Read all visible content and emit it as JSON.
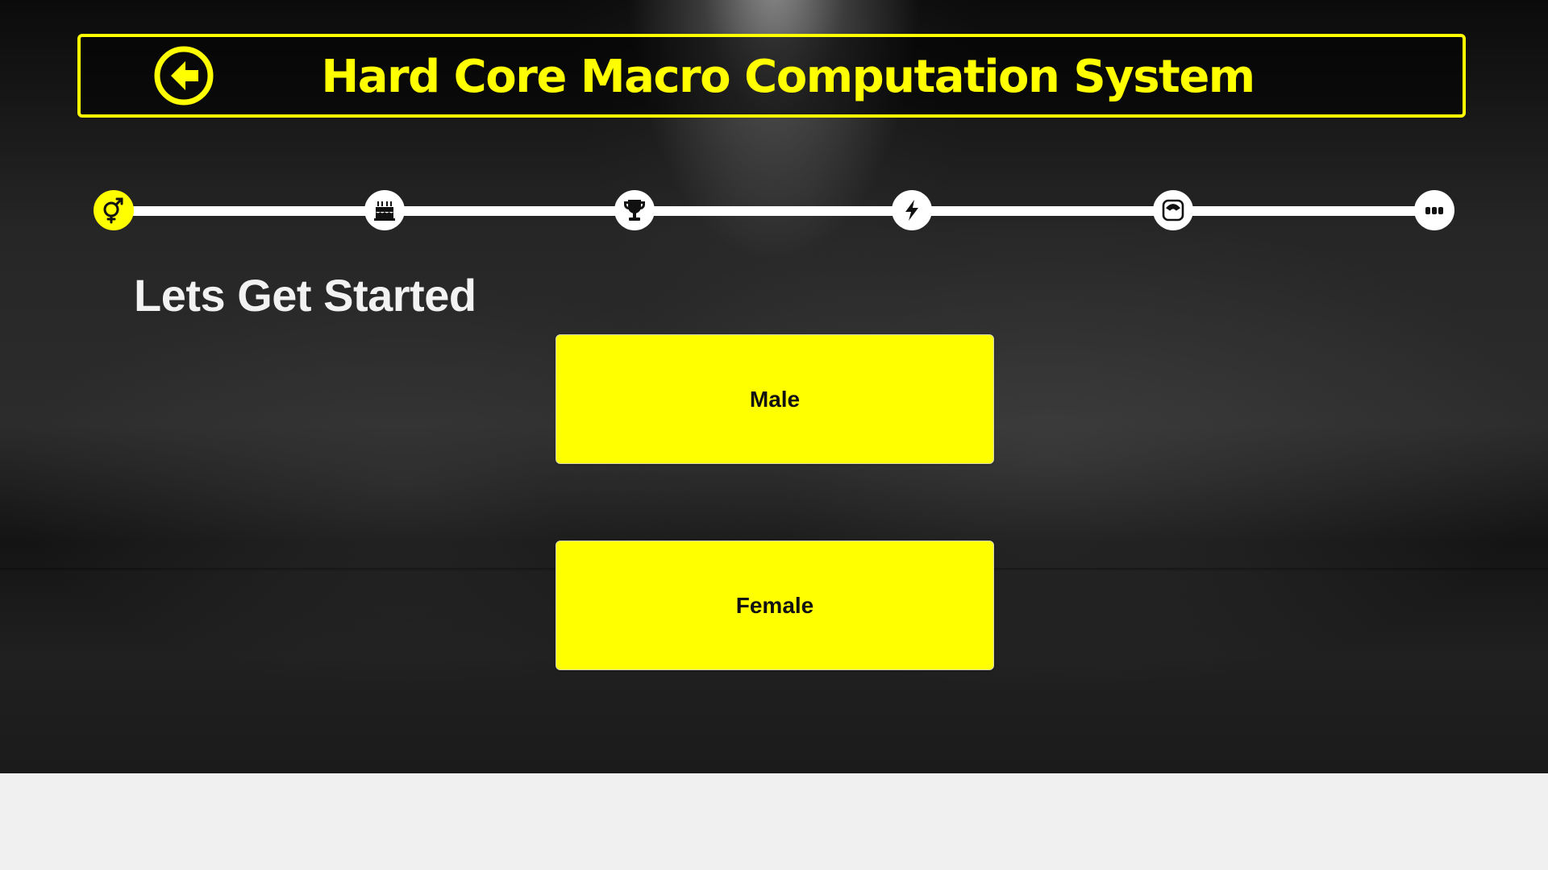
{
  "header": {
    "title": "Hard Core Macro Computation System",
    "back_icon": "arrow-left-circle-icon"
  },
  "progress": {
    "current_step": 1,
    "total_steps": 6,
    "steps": [
      {
        "icon": "gender-icon",
        "active": true
      },
      {
        "icon": "birthday-cake-icon",
        "active": false
      },
      {
        "icon": "trophy-icon",
        "active": false
      },
      {
        "icon": "lightning-bolt-icon",
        "active": false
      },
      {
        "icon": "weight-scale-icon",
        "active": false
      },
      {
        "icon": "more-dots-icon",
        "active": false
      }
    ]
  },
  "main": {
    "heading": "Lets Get Started",
    "options": [
      {
        "label": "Male"
      },
      {
        "label": "Female"
      }
    ]
  },
  "colors": {
    "accent": "#ffff00",
    "text_light": "#f2f2f2",
    "text_dark": "#111111",
    "footer_bg": "#f0f0f0"
  }
}
